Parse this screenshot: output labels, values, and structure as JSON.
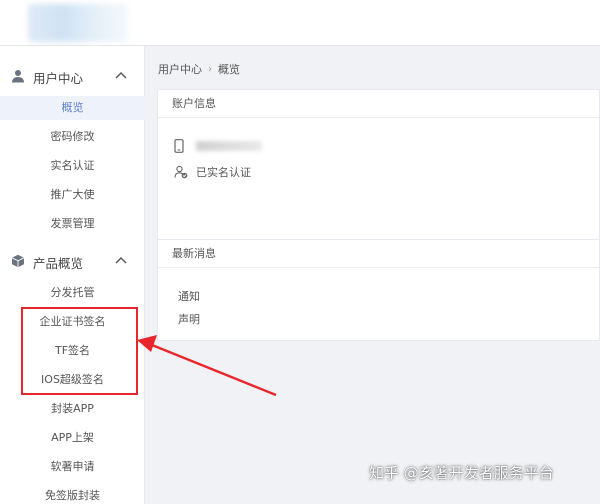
{
  "breadcrumb": {
    "root": "用户中心",
    "separator": "›",
    "current": "概览"
  },
  "sidebar": {
    "groups": [
      {
        "label": "用户中心",
        "icon": "user-icon",
        "expanded": true,
        "items": [
          {
            "label": "概览",
            "active": true
          },
          {
            "label": "密码修改"
          },
          {
            "label": "实名认证"
          },
          {
            "label": "推广大使"
          },
          {
            "label": "发票管理"
          }
        ]
      },
      {
        "label": "产品概览",
        "icon": "cube-icon",
        "expanded": true,
        "items": [
          {
            "label": "分发托管"
          },
          {
            "label": "企业证书签名"
          },
          {
            "label": "TF签名"
          },
          {
            "label": "IOS超级签名"
          },
          {
            "label": "封装APP"
          },
          {
            "label": "APP上架"
          },
          {
            "label": "软著申请"
          },
          {
            "label": "免签版封装"
          }
        ]
      }
    ]
  },
  "account_card": {
    "title": "账户信息",
    "verified_label": "已实名认证"
  },
  "news_card": {
    "title": "最新消息",
    "items": [
      "通知",
      "声明"
    ]
  },
  "watermark": "知乎 @亥著开发者服务平台",
  "colors": {
    "accent": "#5f7fcf",
    "active_bg": "#eef3fb",
    "highlight": "#e8262b",
    "page_bg": "#f0f2f5"
  }
}
